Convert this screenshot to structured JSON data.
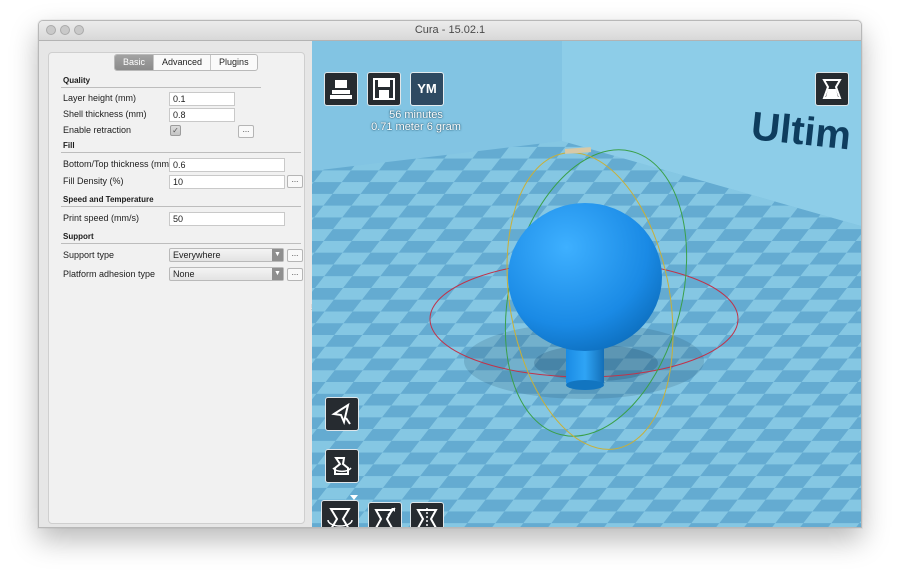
{
  "window": {
    "title": "Cura - 15.02.1"
  },
  "tabs": [
    {
      "label": "Basic",
      "active": true
    },
    {
      "label": "Advanced",
      "active": false
    },
    {
      "label": "Plugins",
      "active": false
    }
  ],
  "quality": {
    "title": "Quality",
    "layer_height_label": "Layer height (mm)",
    "layer_height_value": "0.1",
    "shell_thickness_label": "Shell thickness (mm)",
    "shell_thickness_value": "0.8",
    "retraction_label": "Enable retraction",
    "retraction_checked": true
  },
  "fill": {
    "title": "Fill",
    "bottom_top_label": "Bottom/Top thickness (mm)",
    "bottom_top_value": "0.6",
    "density_label": "Fill Density (%)",
    "density_value": "10"
  },
  "speed": {
    "title": "Speed and Temperature",
    "print_speed_label": "Print speed (mm/s)",
    "print_speed_value": "50"
  },
  "support": {
    "title": "Support",
    "type_label": "Support type",
    "type_value": "Everywhere",
    "adhesion_label": "Platform adhesion type",
    "adhesion_value": "None"
  },
  "more_button_label": "...",
  "viewport": {
    "print_time": "56 minutes",
    "print_material": "0.71 meter 6 gram",
    "ym_label": "YM",
    "wall_text": "Ultim",
    "colors": {
      "floor_light": "#7fc4e2",
      "floor_dark": "#5ca7cf",
      "model": "#1e8fe6",
      "toolbar": "#262b30"
    }
  }
}
